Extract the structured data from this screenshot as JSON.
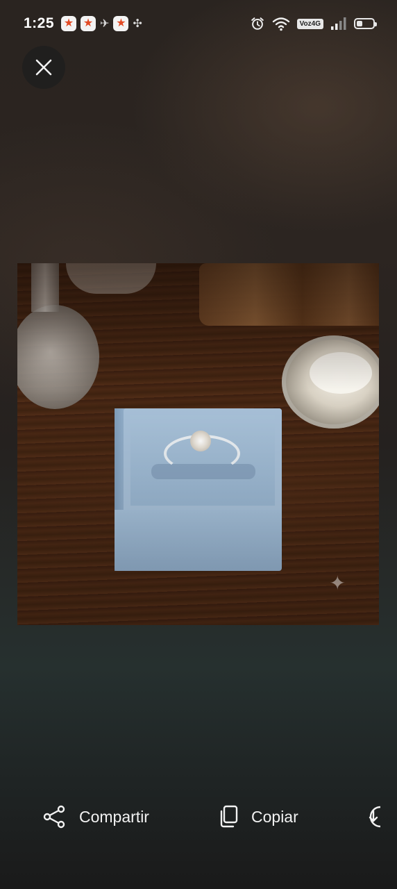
{
  "status_bar": {
    "time": "1:25",
    "network_label": "Voz4G",
    "battery_level": 0.35,
    "icons": [
      "app-badge-icon",
      "app-badge-icon",
      "bird-icon",
      "app-badge-icon",
      "pinwheel-icon",
      "alarm-icon",
      "wifi-icon",
      "signal-icon",
      "battery-icon"
    ]
  },
  "viewer": {
    "close_icon": "close-icon",
    "image_description_icon": "sparkle-icon"
  },
  "actions": {
    "share": {
      "label": "Compartir",
      "icon": "share-icon"
    },
    "copy": {
      "label": "Copiar",
      "icon": "copy-icon"
    },
    "download": {
      "icon": "download-icon"
    }
  },
  "colors": {
    "background": "#1c1a19",
    "text": "#f2f2f2",
    "ring_box": "#a4bfd8"
  }
}
